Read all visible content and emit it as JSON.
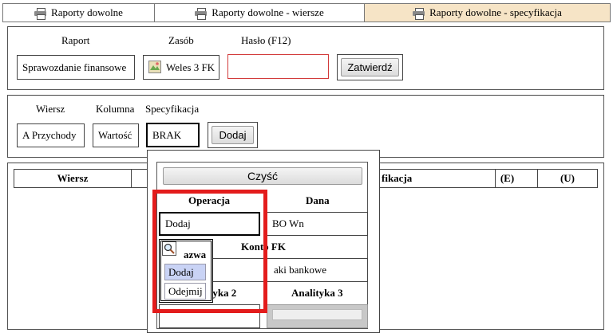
{
  "tabs": [
    {
      "label": "Raporty dowolne"
    },
    {
      "label": "Raporty dowolne - wiersze"
    },
    {
      "label": "Raporty dowolne - specyfikacja"
    }
  ],
  "report": {
    "raport_label": "Raport",
    "zasob_label": "Zasób",
    "haslo_label": "Hasło (F12)",
    "raport_value": "Sprawozdanie finansowe",
    "zasob_value": "Weles 3 FK",
    "haslo_value": "",
    "confirm_label": "Zatwierdź"
  },
  "spec": {
    "wiersz_label": "Wiersz",
    "kolumna_label": "Kolumna",
    "specyfikacja_label": "Specyfikacja",
    "wiersz_value": "A Przychody",
    "kolumna_value": "Wartość",
    "specyfikacja_value": "BRAK",
    "add_label": "Dodaj"
  },
  "table": {
    "headers": [
      "Wiersz",
      "fikacja",
      "(E)",
      "(U)"
    ]
  },
  "popup": {
    "clear_label": "Czyść",
    "operacja_label": "Operacja",
    "dana_label": "Dana",
    "operacja_value": "Dodaj",
    "dana_value": "BO Wn",
    "konto_label": "Konto FK",
    "konto_value": "aki bankowe",
    "analityka2_label": "tyka 2",
    "analityka3_label": "Analityka 3"
  },
  "dropdown": {
    "header": "azwa",
    "options": [
      "Dodaj",
      "Odejmij"
    ],
    "selected_index": 0
  },
  "colors": {
    "active_tab": "#f6e4c6",
    "highlight": "#e31c1c",
    "selected_option": "#c9d3f5",
    "password_border": "#d23a3a"
  }
}
